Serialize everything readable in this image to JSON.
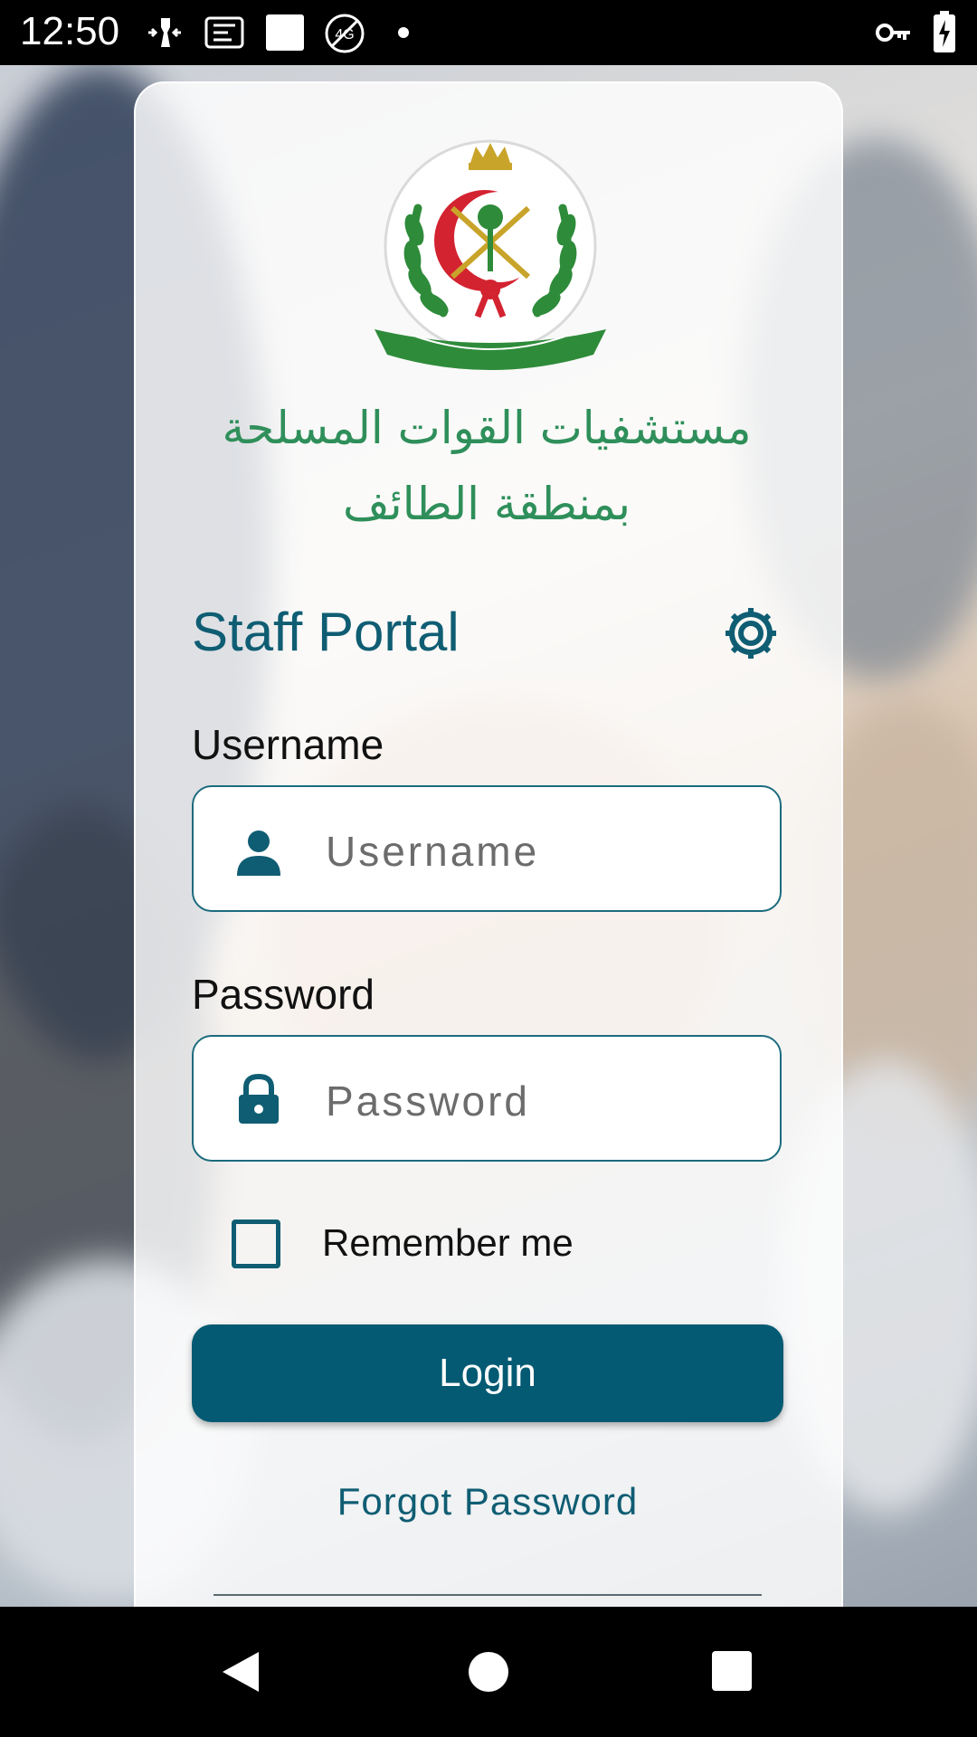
{
  "status_bar": {
    "time": "12:50",
    "left_icons": [
      "bluetooth-transfer-icon",
      "incoming-call-icon",
      "notification-icon",
      "no-signal-4g-icon",
      "dot-icon"
    ],
    "right_icons": [
      "vpn-key-icon",
      "battery-charging-icon"
    ]
  },
  "header": {
    "logo": "armed-forces-hospitals-emblem",
    "arabic_line_1": "مستشفيات القوات المسلحة",
    "arabic_line_2": "بمنطقة الطائف"
  },
  "portal": {
    "title": "Staff Portal",
    "settings_icon": "gear-icon"
  },
  "form": {
    "username_label": "Username",
    "username_placeholder": "Username",
    "username_value": "",
    "password_label": "Password",
    "password_placeholder": "Password",
    "password_value": "",
    "remember_label": "Remember me",
    "remember_checked": false,
    "login_label": "Login",
    "forgot_label": "Forgot Password"
  },
  "colors": {
    "primary": "#045a73",
    "text_primary": "#0f5d73",
    "arabic_green": "#2f8f5a"
  },
  "nav_bar": {
    "buttons": [
      "back-icon",
      "home-icon",
      "recents-icon"
    ]
  }
}
